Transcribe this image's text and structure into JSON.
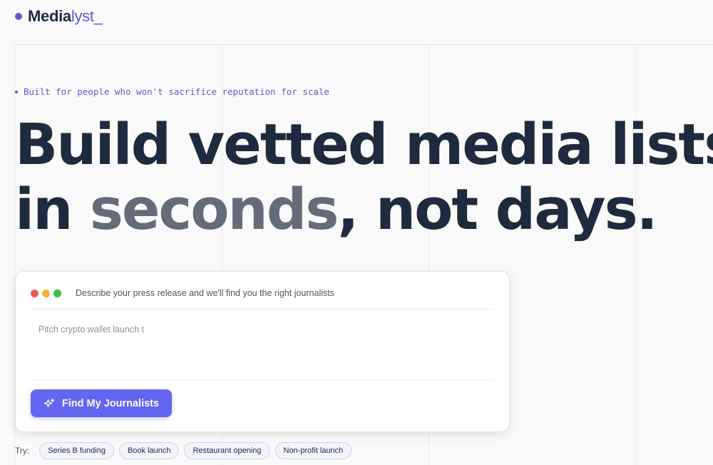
{
  "brand": {
    "name_main": "Media",
    "name_accent": "lyst_"
  },
  "hero": {
    "tagline": "Built for people who won't sacrifice reputation for scale",
    "headline_line1": "Build vetted media lists",
    "headline_in": "in ",
    "headline_highlight": "seconds",
    "headline_end": ", not days."
  },
  "search_card": {
    "hint": "Describe your press release and we'll find you the right journalists",
    "input_value": "Pitch crypto wallet launch t",
    "button_label": "Find My Journalists",
    "button_icon": "sparkle-icon"
  },
  "suggestions": {
    "label": "Try:",
    "chips": [
      "Series B funding",
      "Book launch",
      "Restaurant opening",
      "Non-profit launch"
    ]
  },
  "colors": {
    "accent": "#5b5bd6",
    "button": "#6366f1",
    "heading": "#1e2a3d",
    "muted_heading": "#646c7a"
  }
}
